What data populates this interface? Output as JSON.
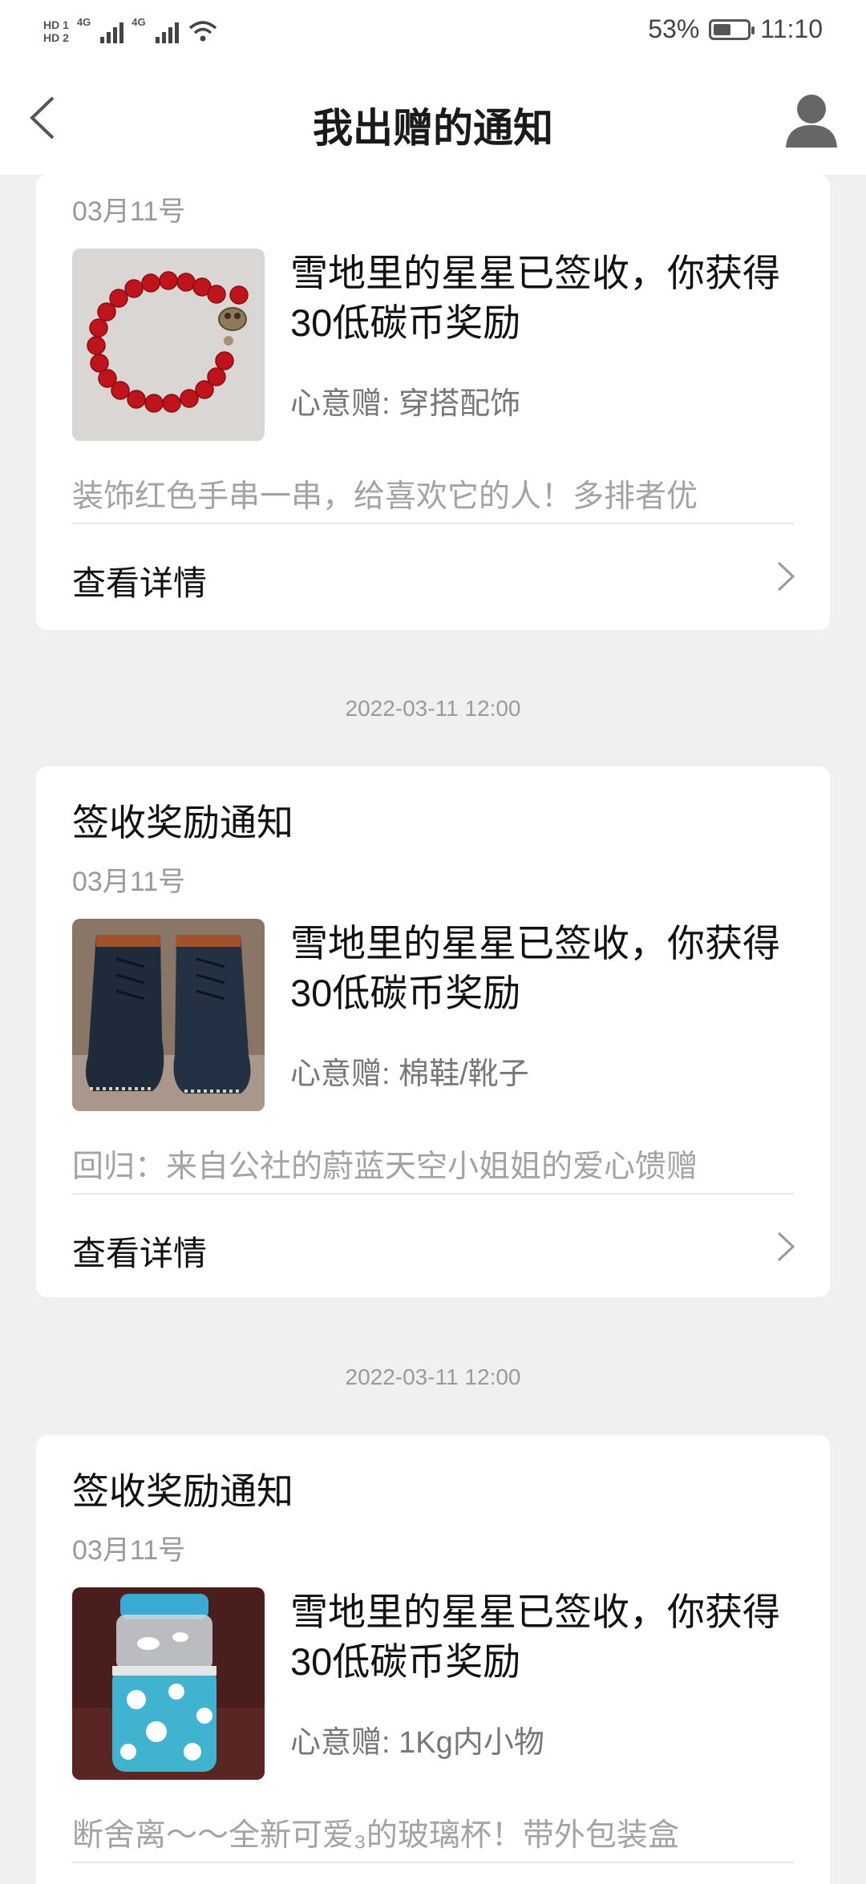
{
  "status_bar": {
    "hd1": "HD 1",
    "hd2": "HD 2",
    "net1": "4G",
    "net2": "4G",
    "battery_text": "53%",
    "battery_level": 0.53,
    "time": "11:10"
  },
  "header": {
    "title": "我出赠的通知",
    "back_icon": "chevron-left-icon",
    "user_icon": "user-avatar-icon"
  },
  "notifications": [
    {
      "title": "",
      "date": "03月11号",
      "message": "雪地里的星星已签收，你获得30低碳币奖励",
      "category": "心意赠: 穿搭配饰",
      "description": "装饰红色手串一串，给喜欢它的人！多排者优",
      "detail_label": "查看详情",
      "image": "red-bead-bracelet"
    },
    {
      "timestamp": "2022-03-11 12:00",
      "title": "签收奖励通知",
      "date": "03月11号",
      "message": "雪地里的星星已签收，你获得30低碳币奖励",
      "category": "心意赠: 棉鞋/靴子",
      "description": "回归：来自公社的蔚蓝天空小姐姐的爱心馈赠",
      "detail_label": "查看详情",
      "image": "black-leather-boots"
    },
    {
      "timestamp": "2022-03-11 12:00",
      "title": "签收奖励通知",
      "date": "03月11号",
      "message": "雪地里的星星已签收，你获得30低碳币奖励",
      "category": "心意赠: 1Kg内小物",
      "description": "断舍离～～全新可爱₃的玻璃杯！带外包装盒",
      "image": "glass-cup-blue-sleeve"
    }
  ]
}
